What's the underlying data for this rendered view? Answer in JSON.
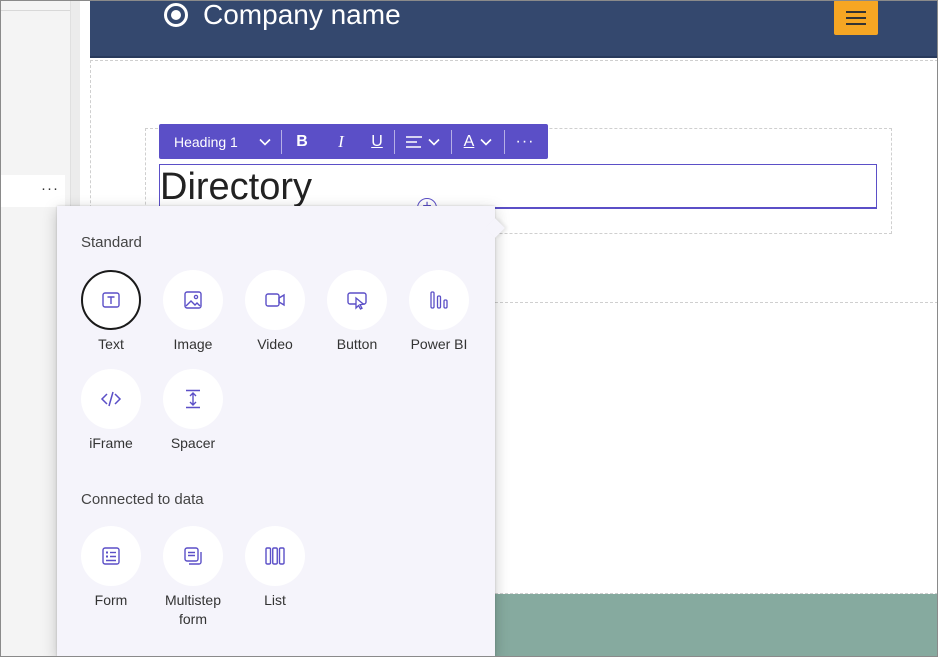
{
  "header": {
    "company_name": "Company name"
  },
  "left_pane": {
    "more_label": "···"
  },
  "editor": {
    "heading_text": "Directory",
    "add_label": "+"
  },
  "toolbar": {
    "style_value": "Heading 1",
    "bold_label": "B",
    "italic_label": "I",
    "underline_label": "U",
    "color_label": "A",
    "more_label": "···"
  },
  "picker": {
    "standard_title": "Standard",
    "standard_items": [
      {
        "label": "Text",
        "icon": "text-icon"
      },
      {
        "label": "Image",
        "icon": "image-icon"
      },
      {
        "label": "Video",
        "icon": "video-icon"
      },
      {
        "label": "Button",
        "icon": "button-icon"
      },
      {
        "label": "Power BI",
        "icon": "power-bi-icon"
      },
      {
        "label": "iFrame",
        "icon": "iframe-icon"
      },
      {
        "label": "Spacer",
        "icon": "spacer-icon"
      }
    ],
    "data_title": "Connected to data",
    "data_items": [
      {
        "label": "Form",
        "icon": "form-icon"
      },
      {
        "label": "Multistep form",
        "icon": "multistep-form-icon"
      },
      {
        "label": "List",
        "icon": "list-icon"
      }
    ]
  },
  "colors": {
    "header_bg": "#34486e",
    "accent": "#5b4fc7",
    "hamburger_bg": "#f6a623",
    "footer_bg": "#86aa9f"
  }
}
